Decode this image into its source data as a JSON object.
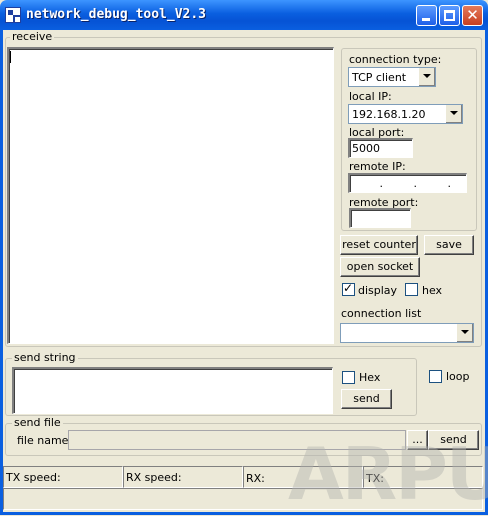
{
  "window": {
    "title": "network_debug_tool_V2.3"
  },
  "receive": {
    "legend": "receive"
  },
  "connection": {
    "type_label": "connection type:",
    "type_value": "TCP client",
    "local_ip_label": "local IP:",
    "local_ip_value": "192.168.1.20",
    "local_port_label": "local port:",
    "local_port_value": "5000",
    "remote_ip_label": "remote IP:",
    "remote_ip_value": "   .   .   .   ",
    "remote_port_label": "remote port:",
    "remote_port_value": ""
  },
  "buttons": {
    "reset_counter": "reset counter",
    "save": "save",
    "open_socket": "open socket",
    "send": "send",
    "browse": "...",
    "send_file": "send"
  },
  "display_options": {
    "display_label": "display",
    "display_checked": true,
    "hex_label": "hex",
    "hex_checked": false
  },
  "connection_list": {
    "label": "connection list",
    "selected": ""
  },
  "send_string": {
    "legend": "send string",
    "hex_label": "Hex",
    "hex_checked": false,
    "loop_label": "loop",
    "loop_checked": false,
    "text": ""
  },
  "send_file": {
    "legend": "send file",
    "file_name_label": "file name",
    "file_name_value": ""
  },
  "status_bar": {
    "tx_speed": "TX speed:",
    "rx_speed": "RX speed:",
    "rx": "RX:",
    "tx": "TX:"
  },
  "watermark": "ARPUN"
}
